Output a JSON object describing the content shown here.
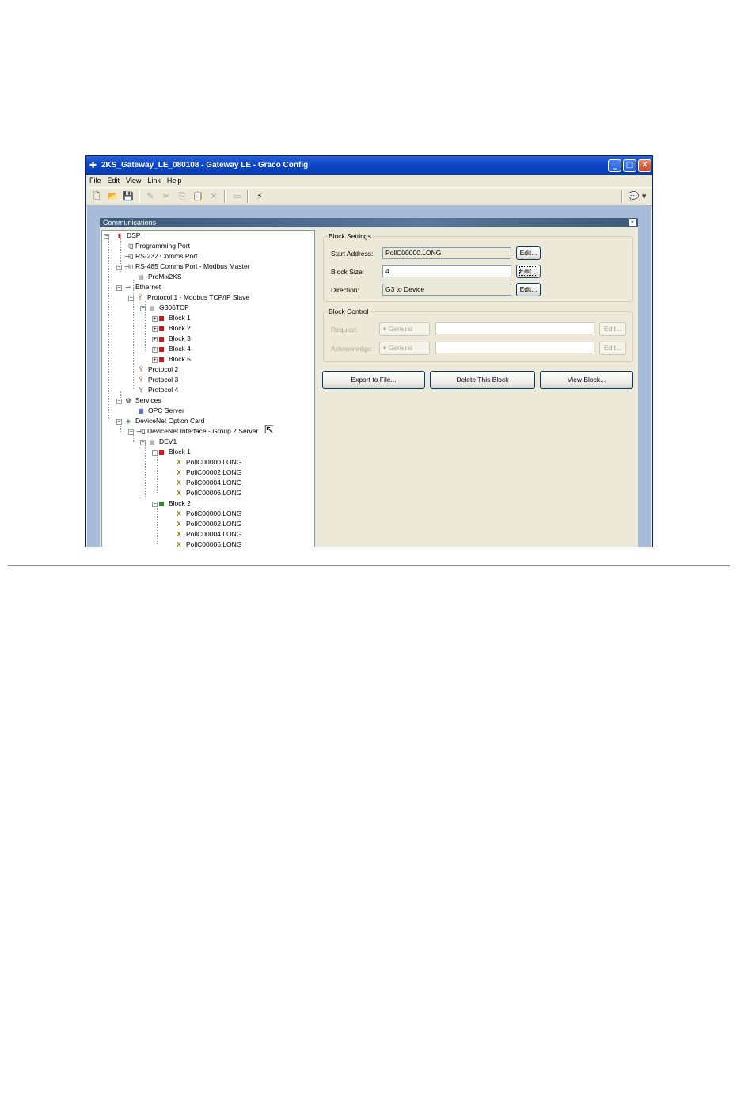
{
  "window": {
    "title": "2KS_Gateway_LE_080108 - Gateway LE - Graco Config",
    "app_icon": "graco-config-icon",
    "controls": {
      "minimize": "_",
      "maximize": "□",
      "close": "✕"
    }
  },
  "menu": [
    "File",
    "Edit",
    "View",
    "Link",
    "Help"
  ],
  "toolbar": {
    "tools": [
      "new-icon",
      "open-icon",
      "save-icon",
      "pencil-icon",
      "cut-icon",
      "copy-icon",
      "paste-icon",
      "delete-icon",
      "window-icon",
      "lightning-icon"
    ],
    "glyphs": [
      "🗋",
      "📂",
      "💾",
      "✎",
      "✂",
      "⎘",
      "📋",
      "✕",
      "▭",
      "⚡"
    ],
    "right_label": "💬 ▾"
  },
  "panel": {
    "title": "Communications",
    "close": "×"
  },
  "tree": [
    {
      "label": "DSP"
    },
    {
      "label": "Programming Port"
    },
    {
      "label": "RS-232 Comms Port"
    },
    {
      "label": "RS-485 Comms Port - Modbus Master"
    },
    {
      "label": "ProMix2KS"
    },
    {
      "label": "Ethernet"
    },
    {
      "label": "Protocol 1 - Modbus TCP/IP Slave"
    },
    {
      "label": "G306TCP"
    },
    {
      "label": "Block 1"
    },
    {
      "label": "Block 2"
    },
    {
      "label": "Block 3"
    },
    {
      "label": "Block 4"
    },
    {
      "label": "Block 5"
    },
    {
      "label": "Protocol 2"
    },
    {
      "label": "Protocol 3"
    },
    {
      "label": "Protocol 4"
    },
    {
      "label": "Services"
    },
    {
      "label": "OPC Server"
    },
    {
      "label": "DeviceNet Option Card"
    },
    {
      "label": "DeviceNet Interface - Group 2 Server"
    },
    {
      "label": "DEV1"
    },
    {
      "label": "Block 1"
    },
    {
      "label": "PollC00000.LONG"
    },
    {
      "label": "PollC00002.LONG"
    },
    {
      "label": "PollC00004.LONG"
    },
    {
      "label": "PollC00006.LONG"
    },
    {
      "label": "Block 2"
    },
    {
      "label": "PollC00000.LONG"
    },
    {
      "label": "PollC00002.LONG"
    },
    {
      "label": "PollC00004.LONG"
    },
    {
      "label": "PollC00006.LONG"
    }
  ],
  "block_settings": {
    "legend": "Block Settings",
    "start_address_label": "Start Address:",
    "start_address_value": "PollC00000.LONG",
    "block_size_label": "Block Size:",
    "block_size_value": "4",
    "direction_label": "Direction:",
    "direction_value": "G3 to Device",
    "edit_label": "Edit..."
  },
  "block_control": {
    "legend": "Block Control",
    "request_label": "Request:",
    "acknowledge_label": "Acknowledge:",
    "general_label": "▾ General",
    "edit_label": "Edit..."
  },
  "actions": {
    "export": "Export to File...",
    "delete": "Delete This Block",
    "view": "View Block..."
  }
}
